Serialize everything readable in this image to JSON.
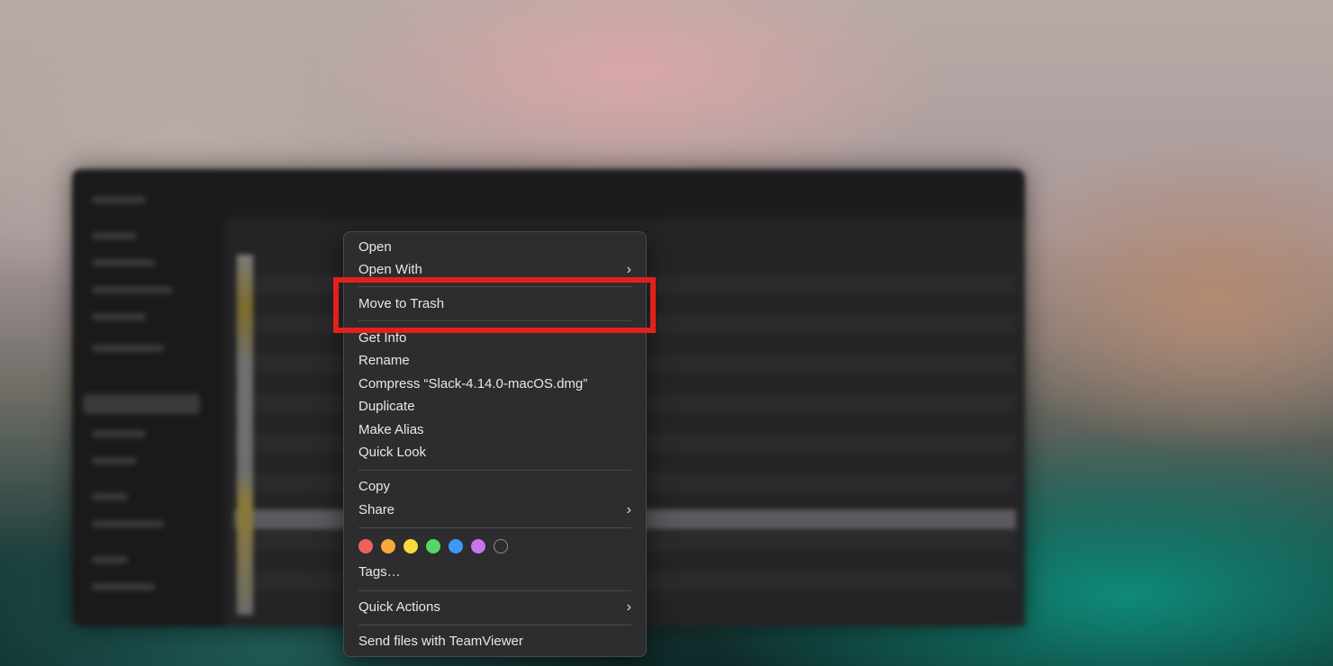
{
  "context_menu": {
    "file_name": "Slack-4.14.0-macOS.dmg",
    "items": [
      {
        "label": "Open",
        "submenu": false
      },
      {
        "label": "Open With",
        "submenu": true
      },
      {
        "label": "Move to Trash",
        "submenu": false,
        "highlighted": true
      },
      {
        "label": "Get Info",
        "submenu": false
      },
      {
        "label": "Rename",
        "submenu": false
      },
      {
        "label": "Compress “Slack-4.14.0-macOS.dmg”",
        "submenu": false
      },
      {
        "label": "Duplicate",
        "submenu": false
      },
      {
        "label": "Make Alias",
        "submenu": false
      },
      {
        "label": "Quick Look",
        "submenu": false
      },
      {
        "label": "Copy",
        "submenu": false
      },
      {
        "label": "Share",
        "submenu": true
      },
      {
        "label": "Tags…",
        "submenu": false
      },
      {
        "label": "Quick Actions",
        "submenu": true
      },
      {
        "label": "Send files with TeamViewer",
        "submenu": false
      }
    ],
    "chevron": "›",
    "tag_colors": [
      {
        "name": "red",
        "color": "#f0605f"
      },
      {
        "name": "orange",
        "color": "#f7a93a"
      },
      {
        "name": "yellow",
        "color": "#f8da3c"
      },
      {
        "name": "green",
        "color": "#56d764"
      },
      {
        "name": "blue",
        "color": "#3a9af4"
      },
      {
        "name": "purple",
        "color": "#c874ec"
      },
      {
        "name": "none",
        "color": "#8e8e90"
      }
    ]
  },
  "annotation": {
    "highlight_color": "#e3201b",
    "target": "Move to Trash"
  }
}
